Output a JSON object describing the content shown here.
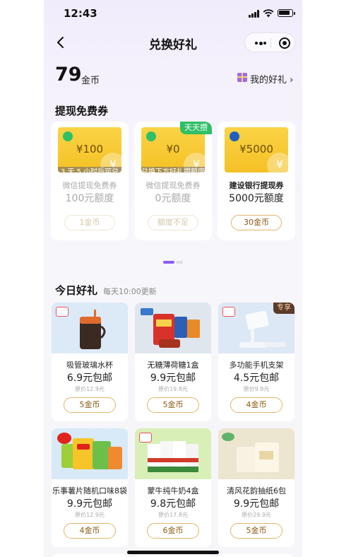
{
  "status_bar": {
    "time": "12:43"
  },
  "nav": {
    "title": "兑换好礼",
    "back_icon": "chevron-left-icon",
    "more_icon": "more-dots-icon",
    "close_icon": "record-target-icon"
  },
  "coins": {
    "amount": "79",
    "unit": "金币"
  },
  "my_gifts": {
    "label": "我的好礼 ›",
    "icon": "gift-box-icon"
  },
  "vouchers_section": {
    "title": "提现免费券",
    "items": [
      {
        "amount": "¥100",
        "overlay": "3 天 5 小时后可兑",
        "name": "微信提现免费券",
        "quota": "100元额度",
        "button": "1金币",
        "active": false,
        "tag": "",
        "color": "#2fbf66"
      },
      {
        "amount": "¥0",
        "overlay": "兑换下方好礼攒额度",
        "name": "微信提现免费券",
        "quota": "0元额度",
        "button": "额度不足",
        "active": false,
        "tag": "天天攒",
        "color": "#2fbf66"
      },
      {
        "amount": "¥5000",
        "overlay": "",
        "name": "建设银行提现券",
        "quota": "5000元额度",
        "button": "30金币",
        "active": true,
        "tag": "",
        "color": "#1f5fbf"
      }
    ]
  },
  "today_section": {
    "title": "今日好礼",
    "subtitle": "每天10:00更新",
    "items": [
      {
        "name": "吸管玻璃水杯",
        "price": "6.9元包邮",
        "orig": "原价12.9元",
        "button": "5金币",
        "badge": "",
        "bg": "#dce9f7"
      },
      {
        "name": "无糖薄荷糖1盒",
        "price": "9.9元包邮",
        "orig": "原价19.8元",
        "button": "5金币",
        "badge": "",
        "bg": "#dfe6ee"
      },
      {
        "name": "多功能手机支架",
        "price": "4.5元包邮",
        "orig": "原价9.8元",
        "button": "4金币",
        "badge": "专享",
        "bg": "#dde8f6"
      },
      {
        "name": "乐事薯片随机口味8袋",
        "price": "9.9元包邮",
        "orig": "原价12.9元",
        "button": "4金币",
        "badge": "",
        "bg": "#d8eaf7"
      },
      {
        "name": "蒙牛纯牛奶4盒",
        "price": "9.8元包邮",
        "orig": "原价17.8元",
        "button": "6金币",
        "badge": "",
        "bg": "#d9efb8"
      },
      {
        "name": "清风花韵抽纸6包",
        "price": "9.9元包邮",
        "orig": "原价29.9元",
        "button": "5金币",
        "badge": "",
        "bg": "#ece5cf"
      }
    ]
  }
}
